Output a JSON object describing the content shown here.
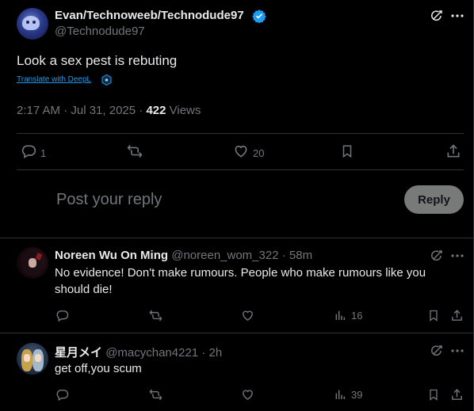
{
  "post": {
    "display_name": "Evan/Technoweeb/Technodude97",
    "handle": "@Technodude97",
    "text": "Look a sex pest is rebuting",
    "translate_label": "Translate with DeepL",
    "time": "2:17 AM · Jul 31, 2025 ·",
    "views_count": "422",
    "views_label": "Views",
    "replies_count": "1",
    "likes_count": "20"
  },
  "reply_box": {
    "placeholder": "Post your reply",
    "button_label": "Reply"
  },
  "replies": [
    {
      "display_name": "Noreen Wu On Ming",
      "handle": "@noreen_wom_322",
      "time": "· 58m",
      "text_line1": "No evidence! Don't make rumours. People who make rumours like you",
      "text_line2": "should die!",
      "views": "16"
    },
    {
      "display_name": "星月メイ",
      "handle": "@macychan4221",
      "time": "· 2h",
      "text_line1": "get off,you scum",
      "views": "39"
    }
  ],
  "colors": {
    "background": "#000000",
    "text": "#e7e9ea",
    "muted": "#71767b",
    "divider": "#2f3336",
    "link": "#1d9bf0",
    "verified": "#1d9bf0",
    "reply_button_bg": "#787a7a"
  },
  "icons": [
    "grok-icon",
    "more-icon",
    "verified-badge-icon",
    "deepl-icon",
    "reply-icon",
    "repost-icon",
    "like-icon",
    "bookmark-icon",
    "share-icon",
    "views-icon"
  ]
}
